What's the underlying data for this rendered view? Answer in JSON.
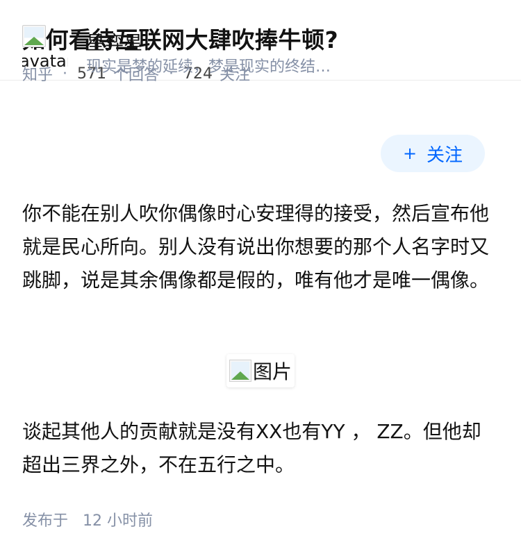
{
  "question": {
    "title": "如何看待互联网大肆吹捧牛顿?",
    "source": "知乎",
    "answer_count": "571",
    "answer_label": "个回答",
    "follow_count": "724",
    "follow_label": "关注"
  },
  "author": {
    "avatar_alt": "avatar",
    "name": "星弈星",
    "bio": "现实是梦的延续，梦是现实的终结…",
    "follow_plus": "+",
    "follow_label": "关注"
  },
  "answer": {
    "paragraph_1": "你不能在别人吹你偶像时心安理得的接受，然后宣布他就是民心所向。别人没有说出你想要的那个人名字时又跳脚，说是其余偶像都是假的，唯有他才是唯一偶像。",
    "image_alt": "图片",
    "paragraph_2": "谈起其他人的贡献就是没有XX也有YY ， ZZ。但他却超出三界之外，不在五行之中。"
  },
  "footer": {
    "published_label": "发布于",
    "published_time": "12 小时前"
  },
  "colors": {
    "title": "#121212",
    "meta": "#8590a6",
    "accent": "#0066ff",
    "follow_bg": "#ebf5ff"
  }
}
